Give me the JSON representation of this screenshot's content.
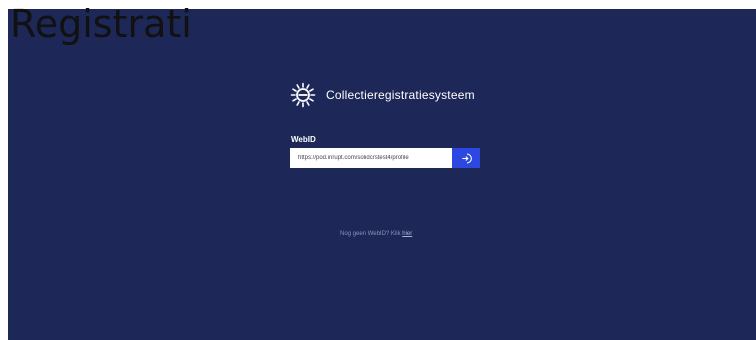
{
  "page_heading": "Registrati",
  "app": {
    "brand_name": "Collectieregistratiesysteem",
    "logo_icon": "e-sunburst-logo-icon",
    "background_color": "#1d2858",
    "accent_color": "#2d48e0"
  },
  "login": {
    "webid_label": "WebID",
    "webid_value": "https://pod.inrupt.com/solidcrstest4/profile",
    "submit_icon": "login-arrow-icon"
  },
  "footer": {
    "prompt_text": "Nog geen WebID? Klik",
    "link_text": "hier"
  }
}
